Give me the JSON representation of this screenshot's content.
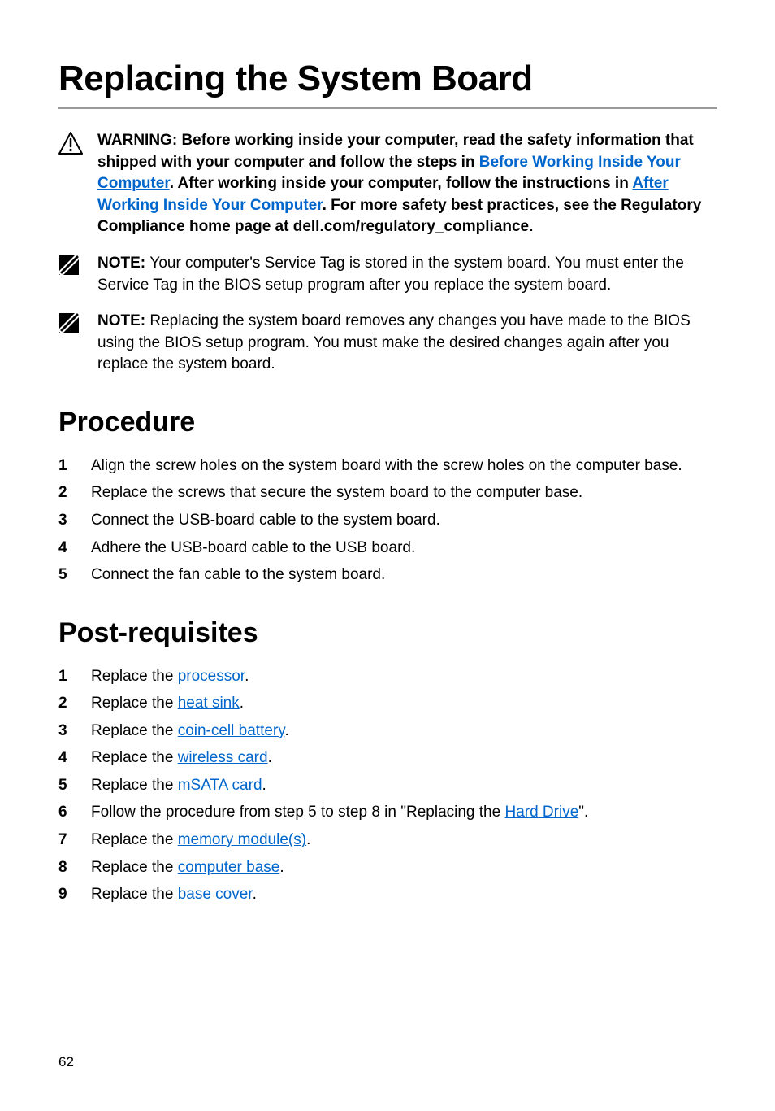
{
  "title": "Replacing the System Board",
  "warning": {
    "prefix": "WARNING: ",
    "seg1": "Before working inside your computer, read the safety information that shipped with your computer and follow the steps in ",
    "link1": "Before Working Inside Your Computer",
    "seg2": ". After working inside your computer, follow the instructions in ",
    "link2": "After Working Inside Your Computer",
    "seg3": ". For more safety best practices, see the Regulatory Compliance home page at dell.com/regulatory_compliance."
  },
  "note1": {
    "prefix": "NOTE: ",
    "text": "Your computer's Service Tag is stored in the system board. You must enter the Service Tag in the BIOS setup program after you replace the system board."
  },
  "note2": {
    "prefix": "NOTE: ",
    "text": "Replacing the system board removes any changes you have made to the BIOS using the BIOS setup program. You must make the desired changes again after you replace the system board."
  },
  "procedure": {
    "heading": "Procedure",
    "items": [
      "Align the screw holes on the system board with the screw holes on the computer base.",
      "Replace the screws that secure the system board to the computer base.",
      "Connect the USB-board cable to the system board.",
      "Adhere the USB-board cable to the USB board.",
      "Connect the fan cable to the system board."
    ]
  },
  "post": {
    "heading": "Post-requisites",
    "items": [
      {
        "pre": "Replace the ",
        "link": "processor",
        "post": "."
      },
      {
        "pre": "Replace the ",
        "link": "heat sink",
        "post": "."
      },
      {
        "pre": "Replace the ",
        "link": "coin-cell battery",
        "post": "."
      },
      {
        "pre": "Replace the ",
        "link": "wireless card",
        "post": "."
      },
      {
        "pre": "Replace the ",
        "link": "mSATA card",
        "post": "."
      },
      {
        "pre": "Follow the procedure from step 5 to step 8 in \"Replacing the ",
        "link": "Hard Drive",
        "post": "\"."
      },
      {
        "pre": "Replace the ",
        "link": "memory module(s)",
        "post": "."
      },
      {
        "pre": "Replace the ",
        "link": "computer base",
        "post": "."
      },
      {
        "pre": "Replace the ",
        "link": "base cover",
        "post": "."
      }
    ]
  },
  "page_number": "62"
}
